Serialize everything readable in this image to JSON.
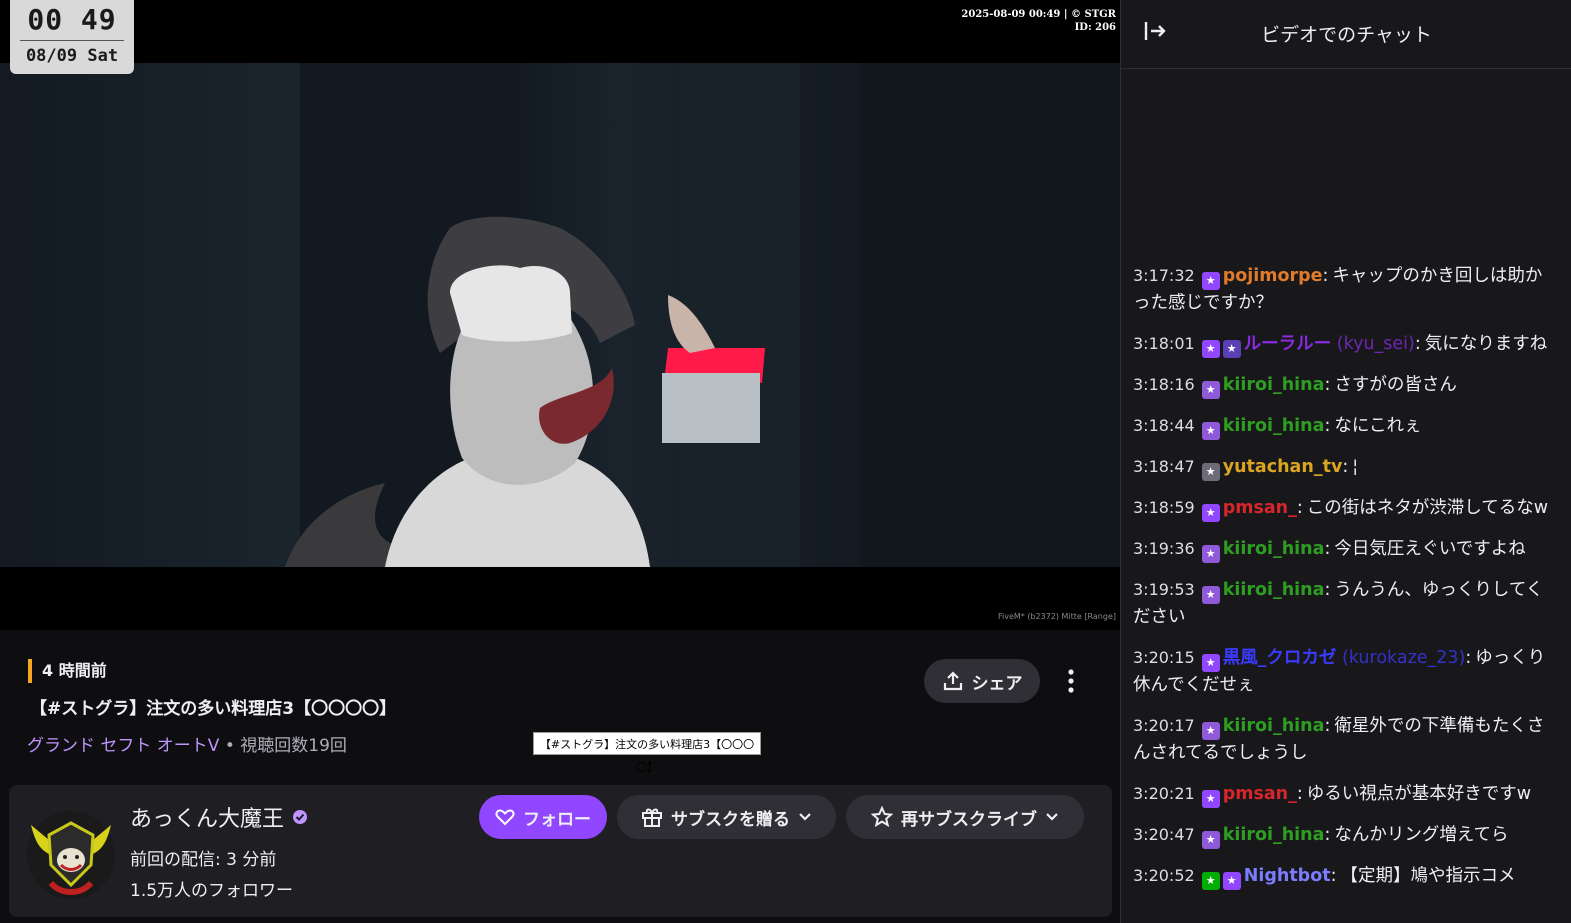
{
  "video": {
    "clock_time": "00 49",
    "clock_date": "08/09 Sat",
    "stamp_line1": "2025-08-09 00:49 | © STGR",
    "stamp_line2": "ID: 206",
    "watermark": "FiveM* (b2372) Mitte [Range]"
  },
  "info": {
    "time_ago": "4 時間前",
    "title": "【#ストグラ】注文の多い料理店3【〇〇〇〇】",
    "game": "グランド セフト オートV",
    "views": " • 視聴回数19回",
    "tooltip": "【#ストグラ】注文の多い料理店3【〇〇〇〇】",
    "share_label": "シェア"
  },
  "channel": {
    "name": "あっくん大魔王",
    "last_stream": "前回の配信: 3 分前",
    "followers": "1.5万人のフォロワー",
    "follow_label": "フォロー",
    "gift_label": "サブスクを贈る",
    "resub_label": "再サブスクライブ"
  },
  "chat": {
    "title": "ビデオでのチャット",
    "messages": [
      {
        "time": "3:17:32",
        "user": "pojimorpe",
        "login": "",
        "text": "キャップのかき回しは助かった感じですか？",
        "color": "#e07b2c",
        "badges": [
          "#9147ff"
        ]
      },
      {
        "time": "3:18:01",
        "user": "ルーラルー",
        "login": " (kyu_sei)",
        "text": "気になりますね",
        "color": "#8a2be2",
        "badges": [
          "#9147ff",
          "#5b3fb5"
        ]
      },
      {
        "time": "3:18:16",
        "user": "kiiroi_hina",
        "login": "",
        "text": "さすがの皆さん",
        "color": "#2e9e22",
        "badges": [
          "#8f5ad9"
        ]
      },
      {
        "time": "3:18:44",
        "user": "kiiroi_hina",
        "login": "",
        "text": "なにこれぇ",
        "color": "#2e9e22",
        "badges": [
          "#8f5ad9"
        ]
      },
      {
        "time": "3:18:47",
        "user": "yutachan_tv",
        "login": "",
        "text": "¦",
        "color": "#daa520",
        "badges": [
          "#6b6b7a"
        ]
      },
      {
        "time": "3:18:59",
        "user": "pmsan_",
        "login": "",
        "text": "この街はネタが渋滞してるなw",
        "color": "#d6262b",
        "badges": [
          "#9147ff"
        ]
      },
      {
        "time": "3:19:36",
        "user": "kiiroi_hina",
        "login": "",
        "text": "今日気圧えぐいですよね",
        "color": "#2e9e22",
        "badges": [
          "#8f5ad9"
        ]
      },
      {
        "time": "3:19:53",
        "user": "kiiroi_hina",
        "login": "",
        "text": "うんうん、ゆっくりしてください",
        "color": "#2e9e22",
        "badges": [
          "#8f5ad9"
        ]
      },
      {
        "time": "3:20:15",
        "user": "黒風_クロカゼ",
        "login": " (kurokaze_23)",
        "text": "ゆっくり休んでくだせぇ",
        "color": "#3b3bff",
        "badges": [
          "#9147ff"
        ]
      },
      {
        "time": "3:20:17",
        "user": "kiiroi_hina",
        "login": "",
        "text": "衛星外での下準備もたくさんされてるでしょうし",
        "color": "#2e9e22",
        "badges": [
          "#8f5ad9"
        ]
      },
      {
        "time": "3:20:21",
        "user": "pmsan_",
        "login": "",
        "text": "ゆるい視点が基本好きですw",
        "color": "#d6262b",
        "badges": [
          "#9147ff"
        ]
      },
      {
        "time": "3:20:47",
        "user": "kiiroi_hina",
        "login": "",
        "text": "なんかリング増えてら",
        "color": "#2e9e22",
        "badges": [
          "#8f5ad9"
        ]
      },
      {
        "time": "3:20:52",
        "user": "Nightbot",
        "login": "",
        "text": "【定期】鳩や指示コメ",
        "color": "#7c7cff",
        "badges": [
          "#00ad03",
          "#9147ff"
        ]
      }
    ]
  }
}
